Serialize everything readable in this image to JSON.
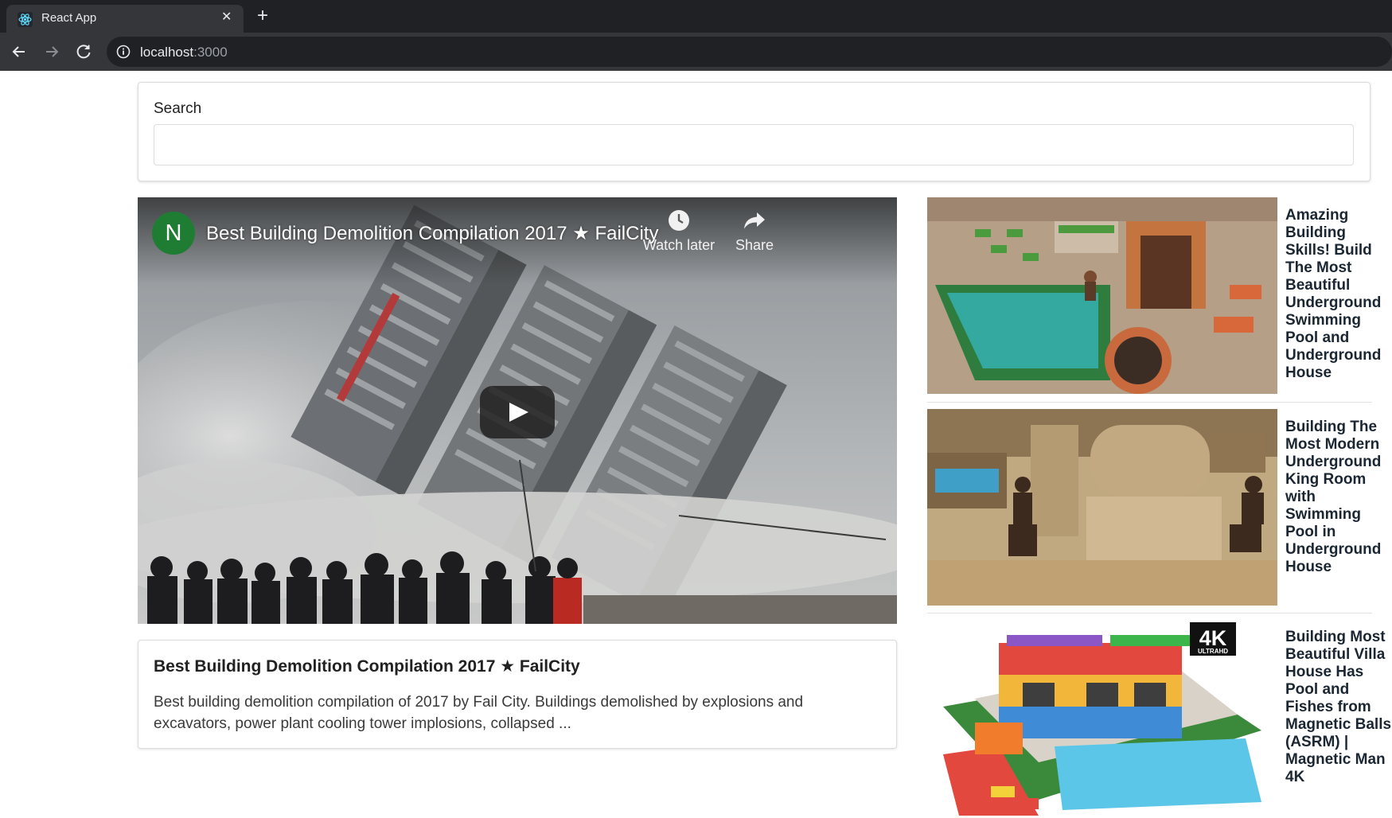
{
  "browser": {
    "tab_title": "React App",
    "tab_close": "✕",
    "new_tab": "+",
    "url_host": "localhost",
    "url_port": ":3000"
  },
  "search": {
    "label": "Search",
    "value": ""
  },
  "player": {
    "channel_initial": "N",
    "title": "Best Building Demolition Compilation 2017 ★ FailCity",
    "watch_later": "Watch later",
    "share": "Share"
  },
  "detail": {
    "title": "Best Building Demolition Compilation 2017 ★ FailCity",
    "description": "Best building demolition compilation of 2017 by Fail City. Buildings demolished by explosions and excavators, power plant cooling tower implosions, collapsed ..."
  },
  "videos": [
    {
      "title": "Amazing Building Skills! Build The Most Beautiful Underground Swimming Pool and Underground House"
    },
    {
      "title": "Building The Most Modern Underground King Room with Swimming Pool in Underground House"
    },
    {
      "title": "Building Most Beautiful Villa House Has Pool and Fishes from Magnetic Balls (ASRM) | Magnetic Man 4K"
    }
  ],
  "thumb_badge": {
    "big": "4K",
    "small": "ULTRAHD"
  },
  "colors": {
    "chrome_dark": "#202124",
    "chrome_toolbar": "#35363a",
    "avatar_green": "#1e7d32"
  }
}
